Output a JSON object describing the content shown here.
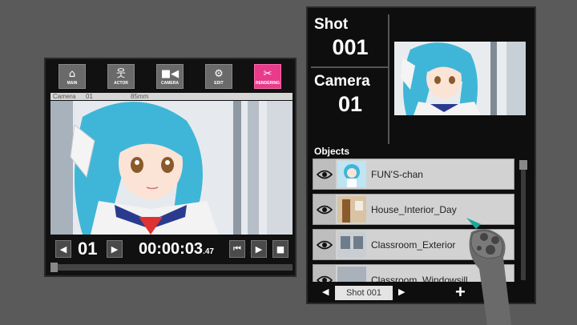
{
  "left_panel": {
    "modes": [
      {
        "label": "MAIN",
        "icon": "home-icon",
        "glyph": "⌂"
      },
      {
        "label": "ACTOR",
        "icon": "actor-icon",
        "glyph": "웃"
      },
      {
        "label": "CAMERA",
        "icon": "camera-icon",
        "glyph": "▰◀"
      },
      {
        "label": "EDIT",
        "icon": "edit-icon",
        "glyph": "⚙"
      },
      {
        "label": "RENDERING",
        "icon": "clapperboard-icon",
        "glyph": "🎬"
      }
    ],
    "active_mode": "RENDERING",
    "camera_info": {
      "camera": "Camera",
      "number": "01",
      "lens": "85mm"
    },
    "frame_number": "01",
    "timecode": "00:00:03",
    "timecode_fraction": ".47"
  },
  "right_panel": {
    "shot_label": "Shot",
    "shot_number": "001",
    "camera_label": "Camera",
    "camera_number": "01",
    "objects_label": "Objects",
    "objects": [
      {
        "name": "FUN'S-chan"
      },
      {
        "name": "House_Interior_Day"
      },
      {
        "name": "Classroom_Exterior"
      },
      {
        "name": "Classroom_Windowsill"
      }
    ],
    "shot_tab": "Shot 001",
    "add_symbol": "+"
  },
  "colors": {
    "background": "#5a5a5a",
    "panel": "#111111",
    "active_mode": "#e83c8a",
    "hair": "#3fb6d8",
    "controller_tip": "#19a99a"
  }
}
